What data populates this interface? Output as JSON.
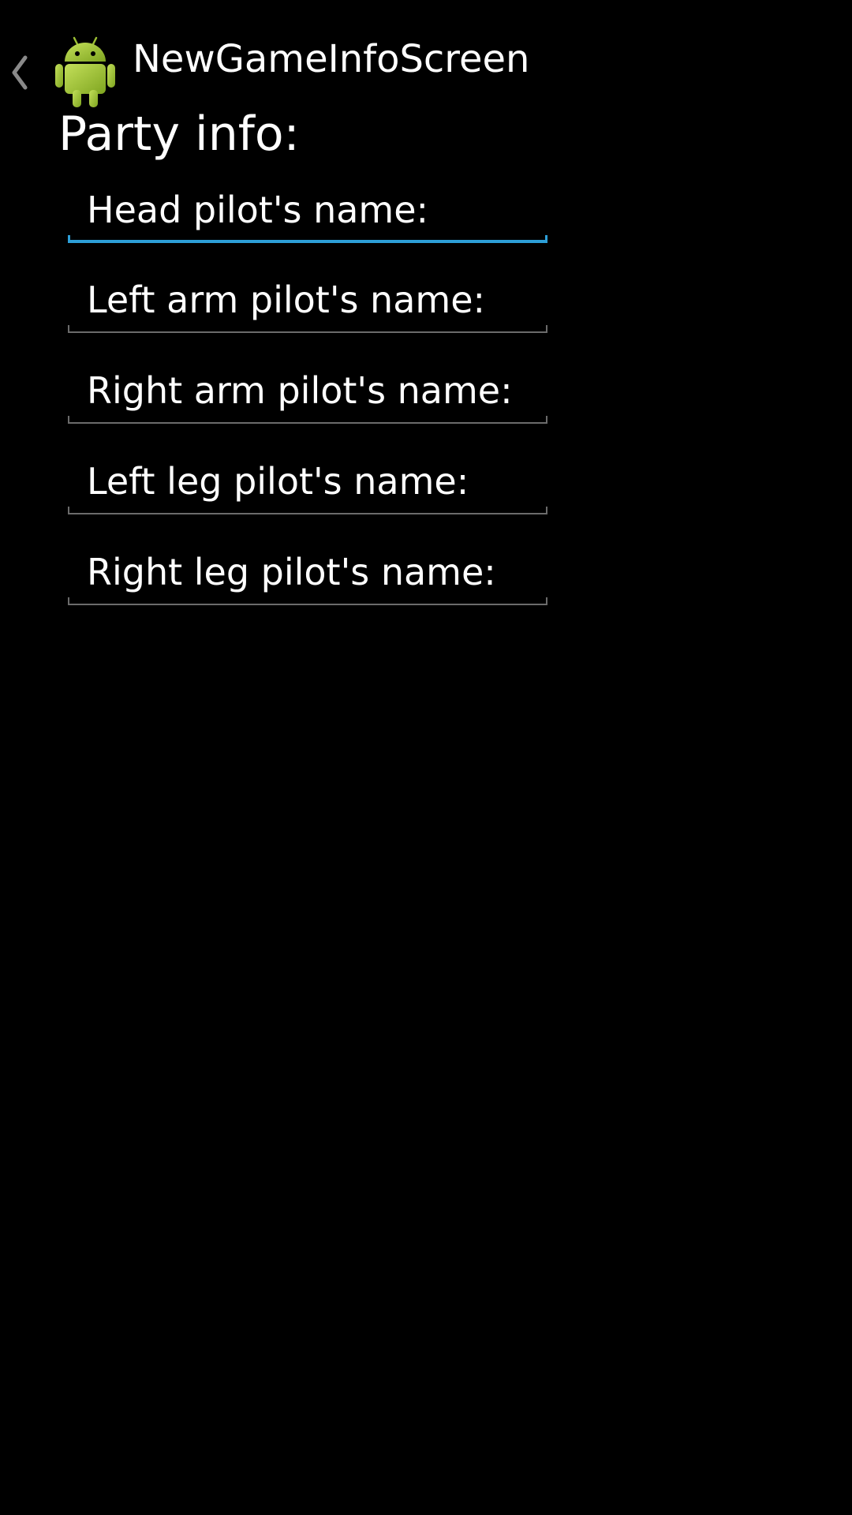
{
  "action_bar": {
    "title": "NewGameInfoScreen",
    "up_icon": "chevron-left-icon",
    "app_icon": "android-robot-icon"
  },
  "content": {
    "heading": "Party info:",
    "fields": [
      {
        "placeholder": "Head pilot's name:",
        "value": "",
        "focused": true
      },
      {
        "placeholder": "Left arm pilot's name:",
        "value": "",
        "focused": false
      },
      {
        "placeholder": "Right arm pilot's name:",
        "value": "",
        "focused": false
      },
      {
        "placeholder": "Left leg pilot's name:",
        "value": "",
        "focused": false
      },
      {
        "placeholder": "Right leg pilot's name:",
        "value": "",
        "focused": false
      }
    ]
  },
  "colors": {
    "background": "#000000",
    "text": "#ffffff",
    "focus_accent": "#2d9fd8",
    "inactive_underline": "#6b6b6b",
    "android_green": "#a4c639"
  }
}
